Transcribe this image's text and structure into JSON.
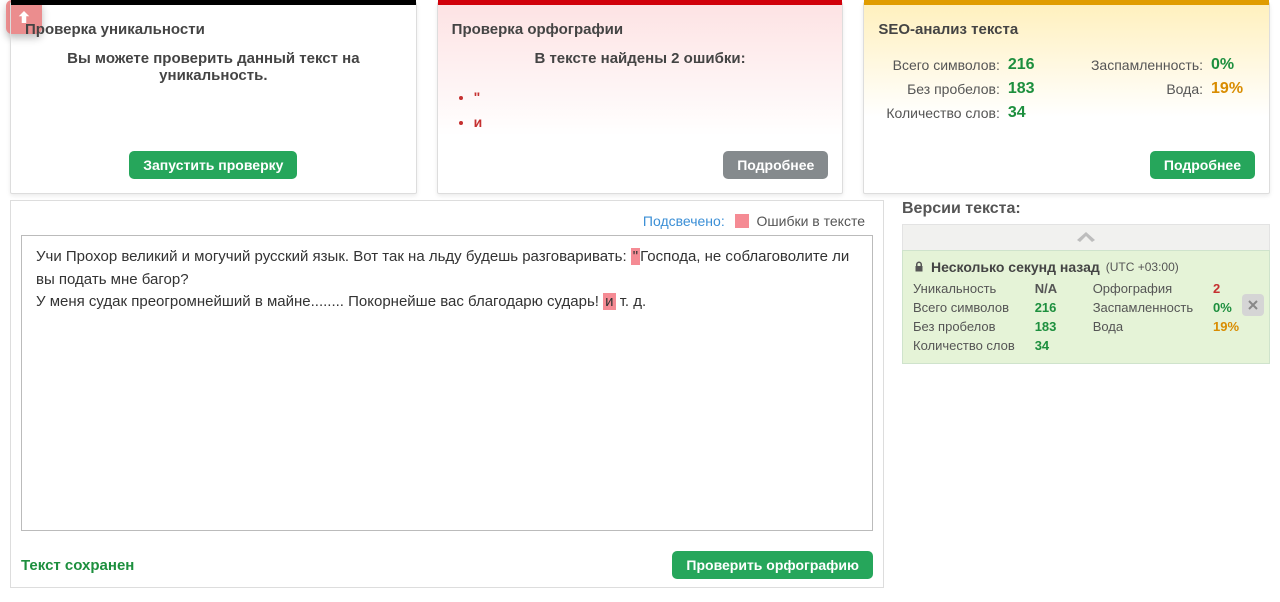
{
  "uniqueness": {
    "title": "Проверка уникальности",
    "subtitle": "Вы можете проверить данный текст на уникальность.",
    "run_label": "Запустить проверку"
  },
  "orthography": {
    "title": "Проверка орфографии",
    "found_label": "В тексте найдены 2 ошибки:",
    "errors": [
      "\"",
      "и"
    ],
    "more_label": "Подробнее"
  },
  "seo": {
    "title": "SEO-анализ текста",
    "rows_left": [
      {
        "label": "Всего символов:",
        "value": "216"
      },
      {
        "label": "Без пробелов:",
        "value": "183"
      },
      {
        "label": "Количество слов:",
        "value": "34"
      }
    ],
    "rows_right": [
      {
        "label": "Заспамленность:",
        "value": "0%",
        "cls": "val-green"
      },
      {
        "label": "Вода:",
        "value": "19%",
        "cls": "val-orange"
      }
    ],
    "more_label": "Подробнее"
  },
  "legend": {
    "highlighted": "Подсвечено:",
    "errors": "Ошибки в тексте"
  },
  "editor": {
    "line1a": "Учи Прохор великий и могучий русский язык. Вот так на льду будешь разговаривать: ",
    "mark1": "\"",
    "line1b": "Господа, не соблаговолите ли вы подать мне багор?",
    "line2a": "У меня судак преогромнейший в майне........ Покорнейше вас благодарю сударь! ",
    "mark2": "и",
    "line2b": " т. д."
  },
  "saved_label": "Текст сохранен",
  "check_btn": "Проверить орфографию",
  "versions": {
    "title": "Версии текста:",
    "when": "Несколько секунд назад",
    "tz": "(UTC +03:00)",
    "rows": [
      {
        "l1": "Уникальность",
        "v1": "N/A",
        "c1": "v-na",
        "l2": "Орфография",
        "v2": "2",
        "c2": "v-red"
      },
      {
        "l1": "Всего символов",
        "v1": "216",
        "c1": "v-green",
        "l2": "Заспамленность",
        "v2": "0%",
        "c2": "v-green"
      },
      {
        "l1": "Без пробелов",
        "v1": "183",
        "c1": "v-green",
        "l2": "Вода",
        "v2": "19%",
        "c2": "v-orange"
      },
      {
        "l1": "Количество слов",
        "v1": "34",
        "c1": "v-green",
        "l2": "",
        "v2": "",
        "c2": ""
      }
    ]
  }
}
